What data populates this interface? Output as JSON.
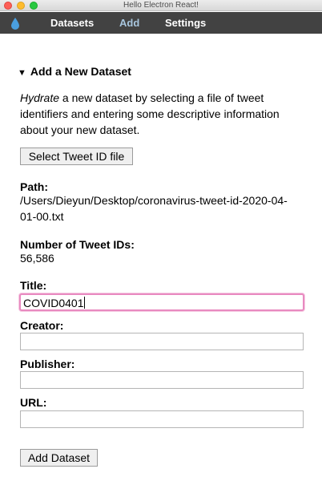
{
  "window": {
    "title": "Hello Electron React!"
  },
  "nav": {
    "items": [
      "Datasets",
      "Add",
      "Settings"
    ],
    "active": "Add"
  },
  "section": {
    "toggle_icon": "triangle-down-icon",
    "heading": "Add a New Dataset",
    "intro_emphasis": "Hydrate",
    "intro_rest": " a new dataset by selecting a file of tweet identifiers and entering some descriptive information about your new dataset."
  },
  "select_button": {
    "label": "Select Tweet ID file"
  },
  "path": {
    "label": "Path:",
    "value": "/Users/Dieyun/Desktop/coronavirus-tweet-id-2020-04-01-00.txt"
  },
  "tweet_count": {
    "label": "Number of Tweet IDs:",
    "value": "56,586"
  },
  "form": {
    "title": {
      "label": "Title:",
      "value": "COVID0401"
    },
    "creator": {
      "label": "Creator:",
      "value": ""
    },
    "publisher": {
      "label": "Publisher:",
      "value": ""
    },
    "url": {
      "label": "URL:",
      "value": ""
    }
  },
  "submit": {
    "label": "Add Dataset"
  },
  "colors": {
    "navbar": "#424242",
    "nav_active": "#a8c6de",
    "focus_ring": "#e88ac0",
    "drop_icon": "#4a9fe0"
  }
}
